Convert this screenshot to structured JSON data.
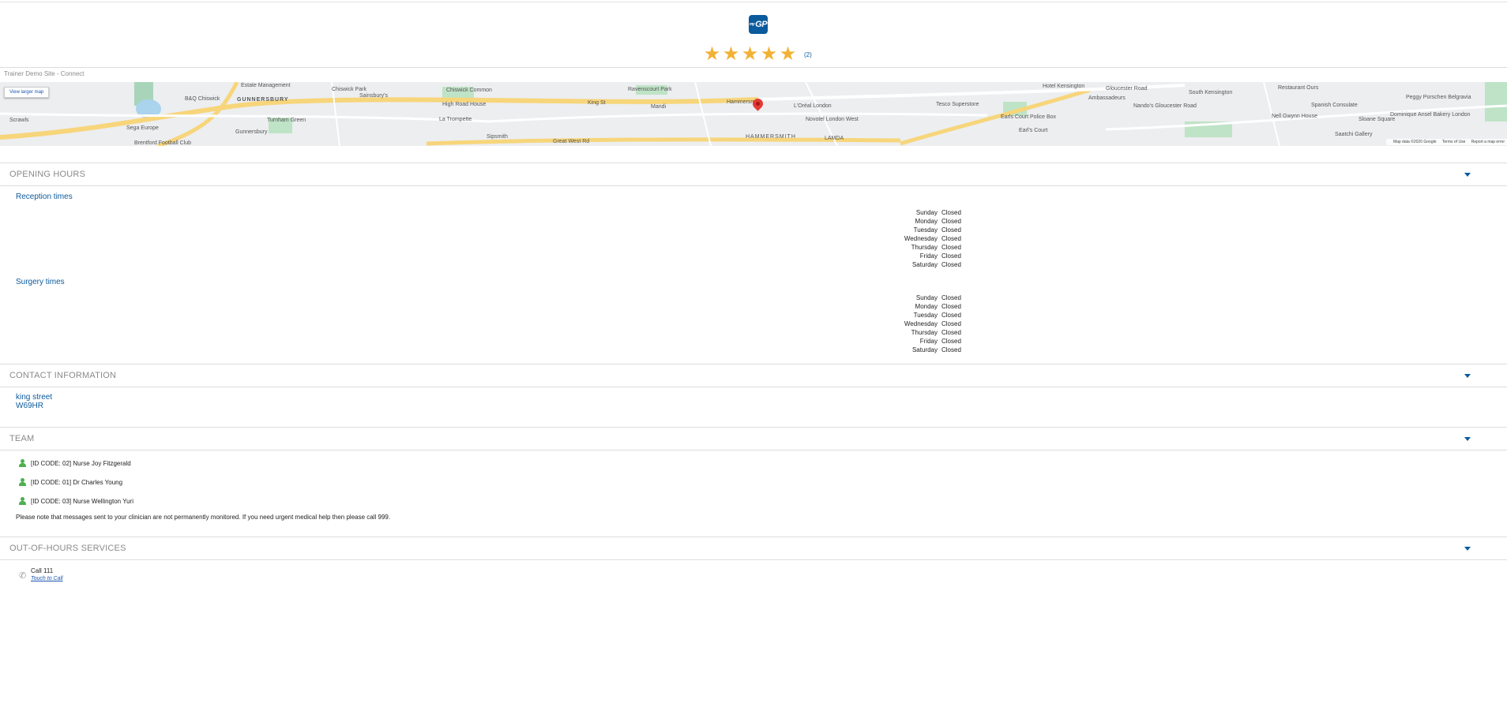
{
  "header": {
    "logo_text": "GP",
    "logo_super": "my",
    "stars": [
      "★",
      "★",
      "★",
      "★",
      "★"
    ],
    "rating_count": "(2)"
  },
  "site_bar": {
    "text": "Trainer Demo Site - Connect"
  },
  "map": {
    "view_larger": "View larger map",
    "footer": [
      "Map data ©2020 Google",
      "Terms of Use",
      "Report a map error"
    ],
    "labels": [
      "Estate Management",
      "GUNNERSBURY",
      "B&Q Chiswick",
      "Chiswick Park",
      "Sainsbury's",
      "Chiswick Common",
      "Ravenscourt Park",
      "High Road House",
      "King St",
      "Hammersmith",
      "L'Oréal London",
      "Tesco Superstore",
      "Hotel Kensington",
      "Gloucester Road",
      "South Kensington",
      "Restaurant Ours",
      "Scrawls",
      "Sega Europe",
      "Turnham Green",
      "La Trompette",
      "Mandi",
      "Nando's Gloucester Road",
      "Nell Gwynn House",
      "Sloane Square",
      "Earls Court Police Box",
      "Earl's Court",
      "Spanish Consulate",
      "Gunnersbury",
      "Brentford Football Club",
      "Sipsmith",
      "Great West Rd",
      "HAMMERSMITH",
      "LAMDA",
      "Saatchi Gallery",
      "Peggy Porschen Belgravia",
      "Novotel London West",
      "Ambassadeurs",
      "Dominique Ansel Bakery London"
    ]
  },
  "sections": {
    "opening_hours": "OPENING HOURS",
    "contact": "CONTACT INFORMATION",
    "team": "TEAM",
    "ooh": "OUT-OF-HOURS SERVICES"
  },
  "reception": {
    "title": "Reception times",
    "rows": [
      {
        "day": "Sunday",
        "status": "Closed"
      },
      {
        "day": "Monday",
        "status": "Closed"
      },
      {
        "day": "Tuesday",
        "status": "Closed"
      },
      {
        "day": "Wednesday",
        "status": "Closed"
      },
      {
        "day": "Thursday",
        "status": "Closed"
      },
      {
        "day": "Friday",
        "status": "Closed"
      },
      {
        "day": "Saturday",
        "status": "Closed"
      }
    ]
  },
  "surgery": {
    "title": "Surgery times",
    "rows": [
      {
        "day": "Sunday",
        "status": "Closed"
      },
      {
        "day": "Monday",
        "status": "Closed"
      },
      {
        "day": "Tuesday",
        "status": "Closed"
      },
      {
        "day": "Wednesday",
        "status": "Closed"
      },
      {
        "day": "Thursday",
        "status": "Closed"
      },
      {
        "day": "Friday",
        "status": "Closed"
      },
      {
        "day": "Saturday",
        "status": "Closed"
      }
    ]
  },
  "contact": {
    "line1": "king street",
    "line2": "W69HR"
  },
  "team": {
    "members": [
      "[ID CODE: 02] Nurse Joy Fitzgerald",
      "[ID CODE: 01] Dr Charles Young",
      "[ID CODE: 03] Nurse Wellington Yuri"
    ],
    "note": "Please note that messages sent to your clinician are not permanently monitored. If you need urgent medical help then please call 999."
  },
  "ooh": {
    "call": "Call 111",
    "link": "Touch to Call"
  },
  "colors": {
    "brand": "#0a5a9c",
    "star": "#f2b134",
    "person": "#4caf50"
  }
}
